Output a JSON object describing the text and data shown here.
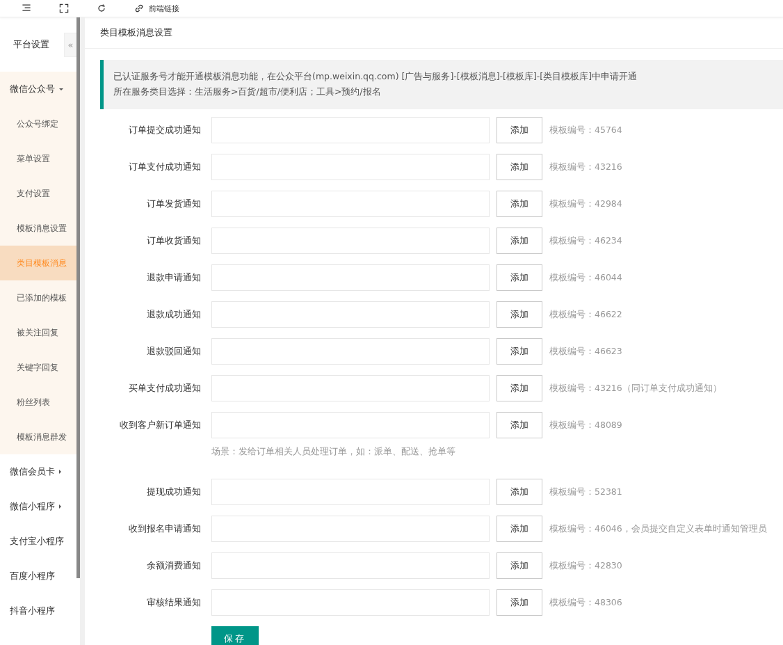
{
  "top_bar": {
    "items": [
      {
        "kind": "menu"
      },
      {
        "kind": "fullscreen"
      },
      {
        "kind": "refresh"
      },
      {
        "kind": "link",
        "label": "前端链接"
      }
    ]
  },
  "sidebar": {
    "title": "平台设置",
    "collapse_icon": "«",
    "items": [
      {
        "label": "微信公众号",
        "kind": "group",
        "expanded": true,
        "selected": false,
        "children": [
          {
            "label": "公众号绑定",
            "selected": false
          },
          {
            "label": "菜单设置",
            "selected": false
          },
          {
            "label": "支付设置",
            "selected": false
          },
          {
            "label": "模板消息设置",
            "selected": false
          },
          {
            "label": "类目模板消息",
            "selected": true
          },
          {
            "label": "已添加的模板",
            "selected": false
          },
          {
            "label": "被关注回复",
            "selected": false
          },
          {
            "label": "关键字回复",
            "selected": false
          },
          {
            "label": "粉丝列表",
            "selected": false
          },
          {
            "label": "模板消息群发",
            "selected": false
          }
        ]
      },
      {
        "label": "微信会员卡",
        "kind": "group",
        "expanded": false,
        "selected": false
      },
      {
        "label": "微信小程序",
        "kind": "group",
        "expanded": false,
        "selected": false
      },
      {
        "label": "支付宝小程序",
        "selected": false
      },
      {
        "label": "百度小程序",
        "selected": false
      },
      {
        "label": "抖音小程序",
        "selected": false
      }
    ]
  },
  "page": {
    "title": "类目模板消息设置",
    "notice": [
      "已认证服务号才能开通模板消息功能，在公众平台(mp.weixin.qq.com) [广告与服务]-[模板消息]-[模板库]-[类目模板库]中申请开通",
      "所在服务类目选择：生活服务>百货/超市/便利店；工具>预约/报名"
    ],
    "rows": [
      {
        "label": "订单提交成功通知",
        "button": "添加",
        "code": "模板编号：45764"
      },
      {
        "label": "订单支付成功通知",
        "button": "添加",
        "code": "模板编号：43216"
      },
      {
        "label": "订单发货通知",
        "button": "添加",
        "code": "模板编号：42984"
      },
      {
        "label": "订单收货通知",
        "button": "添加",
        "code": "模板编号：46234"
      },
      {
        "label": "退款申请通知",
        "button": "添加",
        "code": "模板编号：46044"
      },
      {
        "label": "退款成功通知",
        "button": "添加",
        "code": "模板编号：46622"
      },
      {
        "label": "退款驳回通知",
        "button": "添加",
        "code": "模板编号：46623"
      },
      {
        "label": "买单支付成功通知",
        "button": "添加",
        "code": "模板编号：43216（同订单支付成功通知）"
      },
      {
        "label": "收到客户新订单通知",
        "button": "添加",
        "code": "模板编号：48089",
        "hint": "场景：发给订单相关人员处理订单，如：派单、配送、抢单等"
      },
      {
        "label": "提现成功通知",
        "button": "添加",
        "code": "模板编号：52381"
      },
      {
        "label": "收到报名申请通知",
        "button": "添加",
        "code": "模板编号：46046，会员提交自定义表单时通知管理员"
      },
      {
        "label": "余额消费通知",
        "button": "添加",
        "code": "模板编号：42830"
      },
      {
        "label": "审核结果通知",
        "button": "添加",
        "code": "模板编号：48306"
      }
    ],
    "save_button": "保存"
  }
}
